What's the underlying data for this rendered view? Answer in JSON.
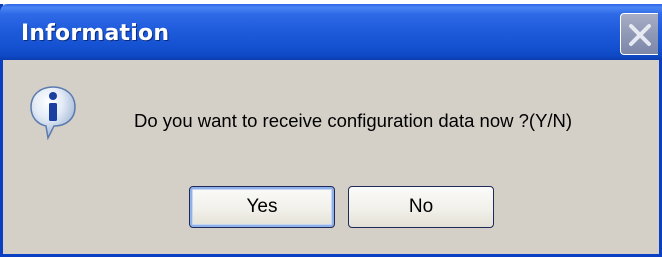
{
  "dialog": {
    "title": "Information",
    "message": "Do you want to receive configuration data now ?(Y/N)",
    "icon": "information-icon",
    "buttons": {
      "yes_label": "Yes",
      "no_label": "No"
    },
    "close_icon": "close-icon"
  },
  "colors": {
    "titlebar": "#1f5cdc",
    "dialog_background": "#d4d0c8",
    "frame": "#0a3fc4",
    "title_text": "#ffffff"
  }
}
